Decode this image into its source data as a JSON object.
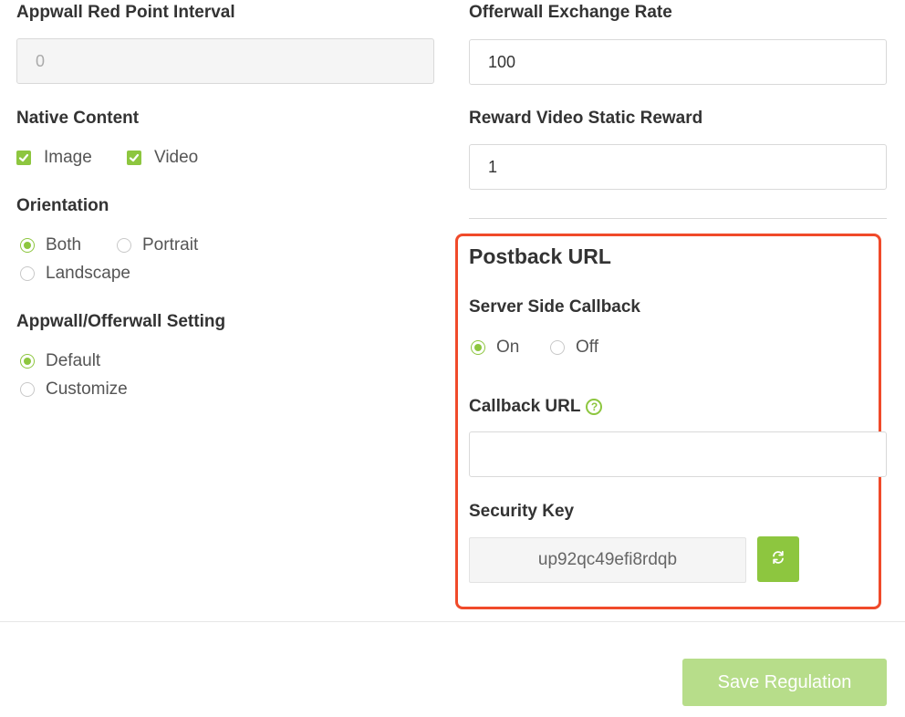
{
  "left": {
    "red_point": {
      "label": "Appwall Red Point Interval",
      "value": "0"
    },
    "native_content": {
      "label": "Native Content",
      "options": [
        "Image",
        "Video"
      ]
    },
    "orientation": {
      "label": "Orientation",
      "options": [
        "Both",
        "Portrait",
        "Landscape"
      ],
      "selected": "Both"
    },
    "appwall_setting": {
      "label": "Appwall/Offerwall Setting",
      "options": [
        "Default",
        "Customize"
      ],
      "selected": "Default"
    }
  },
  "right": {
    "exchange_rate": {
      "label": "Offerwall Exchange Rate",
      "value": "100"
    },
    "static_reward": {
      "label": "Reward Video Static Reward",
      "value": "1"
    },
    "postback": {
      "title": "Postback URL",
      "server_callback": {
        "label": "Server Side Callback",
        "options": [
          "On",
          "Off"
        ],
        "selected": "On"
      },
      "callback_url": {
        "label": "Callback URL",
        "value": ""
      },
      "security_key": {
        "label": "Security Key",
        "value": "up92qc49efi8rdqb"
      }
    }
  },
  "save_label": "Save Regulation",
  "colors": {
    "accent": "#8dc63f",
    "highlight": "#f04a2a",
    "save_button": "#b7dd8a"
  },
  "icons": {
    "help": "question-circle-icon",
    "refresh": "refresh-arrows-icon",
    "check": "check-icon"
  }
}
